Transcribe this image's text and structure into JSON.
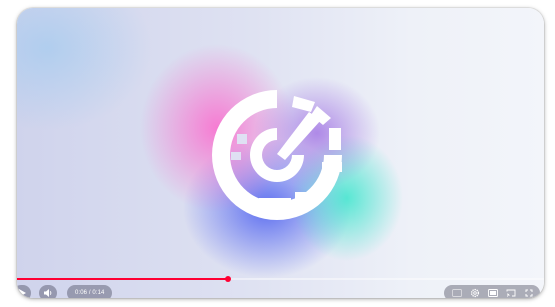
{
  "player": {
    "time_display": "0:06 / 0:14",
    "progress": 0.4,
    "accent_color": "#ff0033"
  },
  "controls": {
    "left": [
      {
        "name": "play-icon"
      },
      {
        "name": "volume-icon"
      }
    ],
    "right": [
      {
        "name": "subtitles-icon"
      },
      {
        "name": "settings-gear-icon"
      },
      {
        "name": "miniplayer-icon"
      },
      {
        "name": "cast-icon"
      },
      {
        "name": "fullscreen-icon"
      }
    ]
  }
}
